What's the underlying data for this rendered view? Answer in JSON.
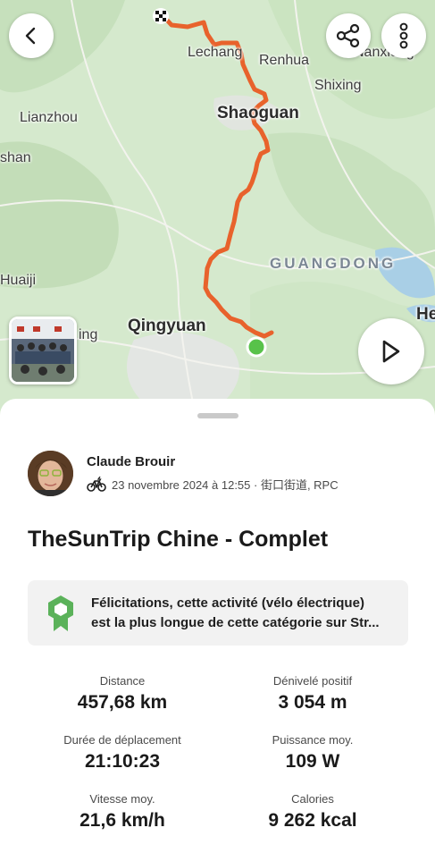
{
  "map": {
    "labels": {
      "lechang": "Lechang",
      "renhua": "Renhua",
      "nanxiong": "Nanxiong",
      "shixing": "Shixing",
      "lianzhou": "Lianzhou",
      "shaoguan": "Shaoguan",
      "shan": "shan",
      "guangdong": "GUANGDONG",
      "huaiji": "Huaiji",
      "qingyuan": "Qingyuan",
      "ing": "ing",
      "he": "He"
    },
    "route_color": "#e8622c",
    "start_marker_color": "#58c24a"
  },
  "header": {
    "back_icon": "chevron-left-icon",
    "share_icon": "share-icon",
    "more_icon": "more-vertical-icon"
  },
  "activity": {
    "athlete_name": "Claude Brouir",
    "sport_icon": "ebike-icon",
    "meta": "23 novembre 2024 à 12:55 · 街口街道, RPC",
    "title": "TheSunTrip Chine - Complet",
    "achievement": {
      "icon": "achievement-badge-icon",
      "line1": "Félicitations, cette activité (vélo électrique)",
      "line2": "est la plus longue de cette catégorie sur Str..."
    },
    "stats": [
      {
        "label": "Distance",
        "value": "457,68 km"
      },
      {
        "label": "Dénivelé positif",
        "value": "3 054 m"
      },
      {
        "label": "Durée de déplacement",
        "value": "21:10:23"
      },
      {
        "label": "Puissance moy.",
        "value": "109 W"
      },
      {
        "label": "Vitesse moy.",
        "value": "21,6 km/h"
      },
      {
        "label": "Calories",
        "value": "9 262 kcal"
      }
    ]
  },
  "colors": {
    "accent": "#fc5200",
    "badge_green": "#5bb25a"
  }
}
